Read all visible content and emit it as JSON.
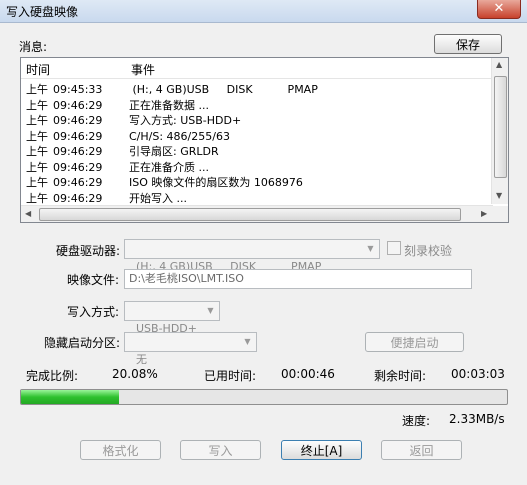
{
  "window": {
    "title": "写入硬盘映像",
    "close_glyph": "✕"
  },
  "log": {
    "label": "消息:",
    "save_label": "保存",
    "columns": [
      "时间",
      "事件"
    ],
    "rows": [
      {
        "ampm": "上午",
        "time": "09:45:33",
        "event": " (H:, 4 GB)USB     DISK          PMAP"
      },
      {
        "ampm": "上午",
        "time": "09:46:29",
        "event": "正在准备数据 ..."
      },
      {
        "ampm": "上午",
        "time": "09:46:29",
        "event": "写入方式: USB-HDD+"
      },
      {
        "ampm": "上午",
        "time": "09:46:29",
        "event": "C/H/S: 486/255/63"
      },
      {
        "ampm": "上午",
        "time": "09:46:29",
        "event": "引导扇区: GRLDR"
      },
      {
        "ampm": "上午",
        "time": "09:46:29",
        "event": "正在准备介质 ..."
      },
      {
        "ampm": "上午",
        "time": "09:46:29",
        "event": "ISO 映像文件的扇区数为 1068976"
      },
      {
        "ampm": "上午",
        "time": "09:46:29",
        "event": "开始写入 ..."
      }
    ]
  },
  "form": {
    "drive_label": "硬盘驱动器:",
    "drive_value": "(H:, 4 GB)USB     DISK          PMAP",
    "verify_label": "刻录校验",
    "image_label": "映像文件:",
    "image_value": "D:\\老毛桃ISO\\LMT.ISO",
    "write_mode_label": "写入方式:",
    "write_mode_value": "USB-HDD+",
    "hidden_partition_label": "隐藏启动分区:",
    "hidden_partition_value": "无",
    "quick_boot_label": "便捷启动"
  },
  "status": {
    "complete_label": "完成比例:",
    "complete_value": "20.08%",
    "elapsed_label": "已用时间:",
    "elapsed_value": "00:00:46",
    "remaining_label": "剩余时间:",
    "remaining_value": "00:03:03",
    "progress_fraction": 0.2008,
    "speed_label": "速度:",
    "speed_value": "2.33MB/s"
  },
  "buttons": {
    "format": "格式化",
    "write": "写入",
    "stop": "终止[A]",
    "back": "返回"
  }
}
